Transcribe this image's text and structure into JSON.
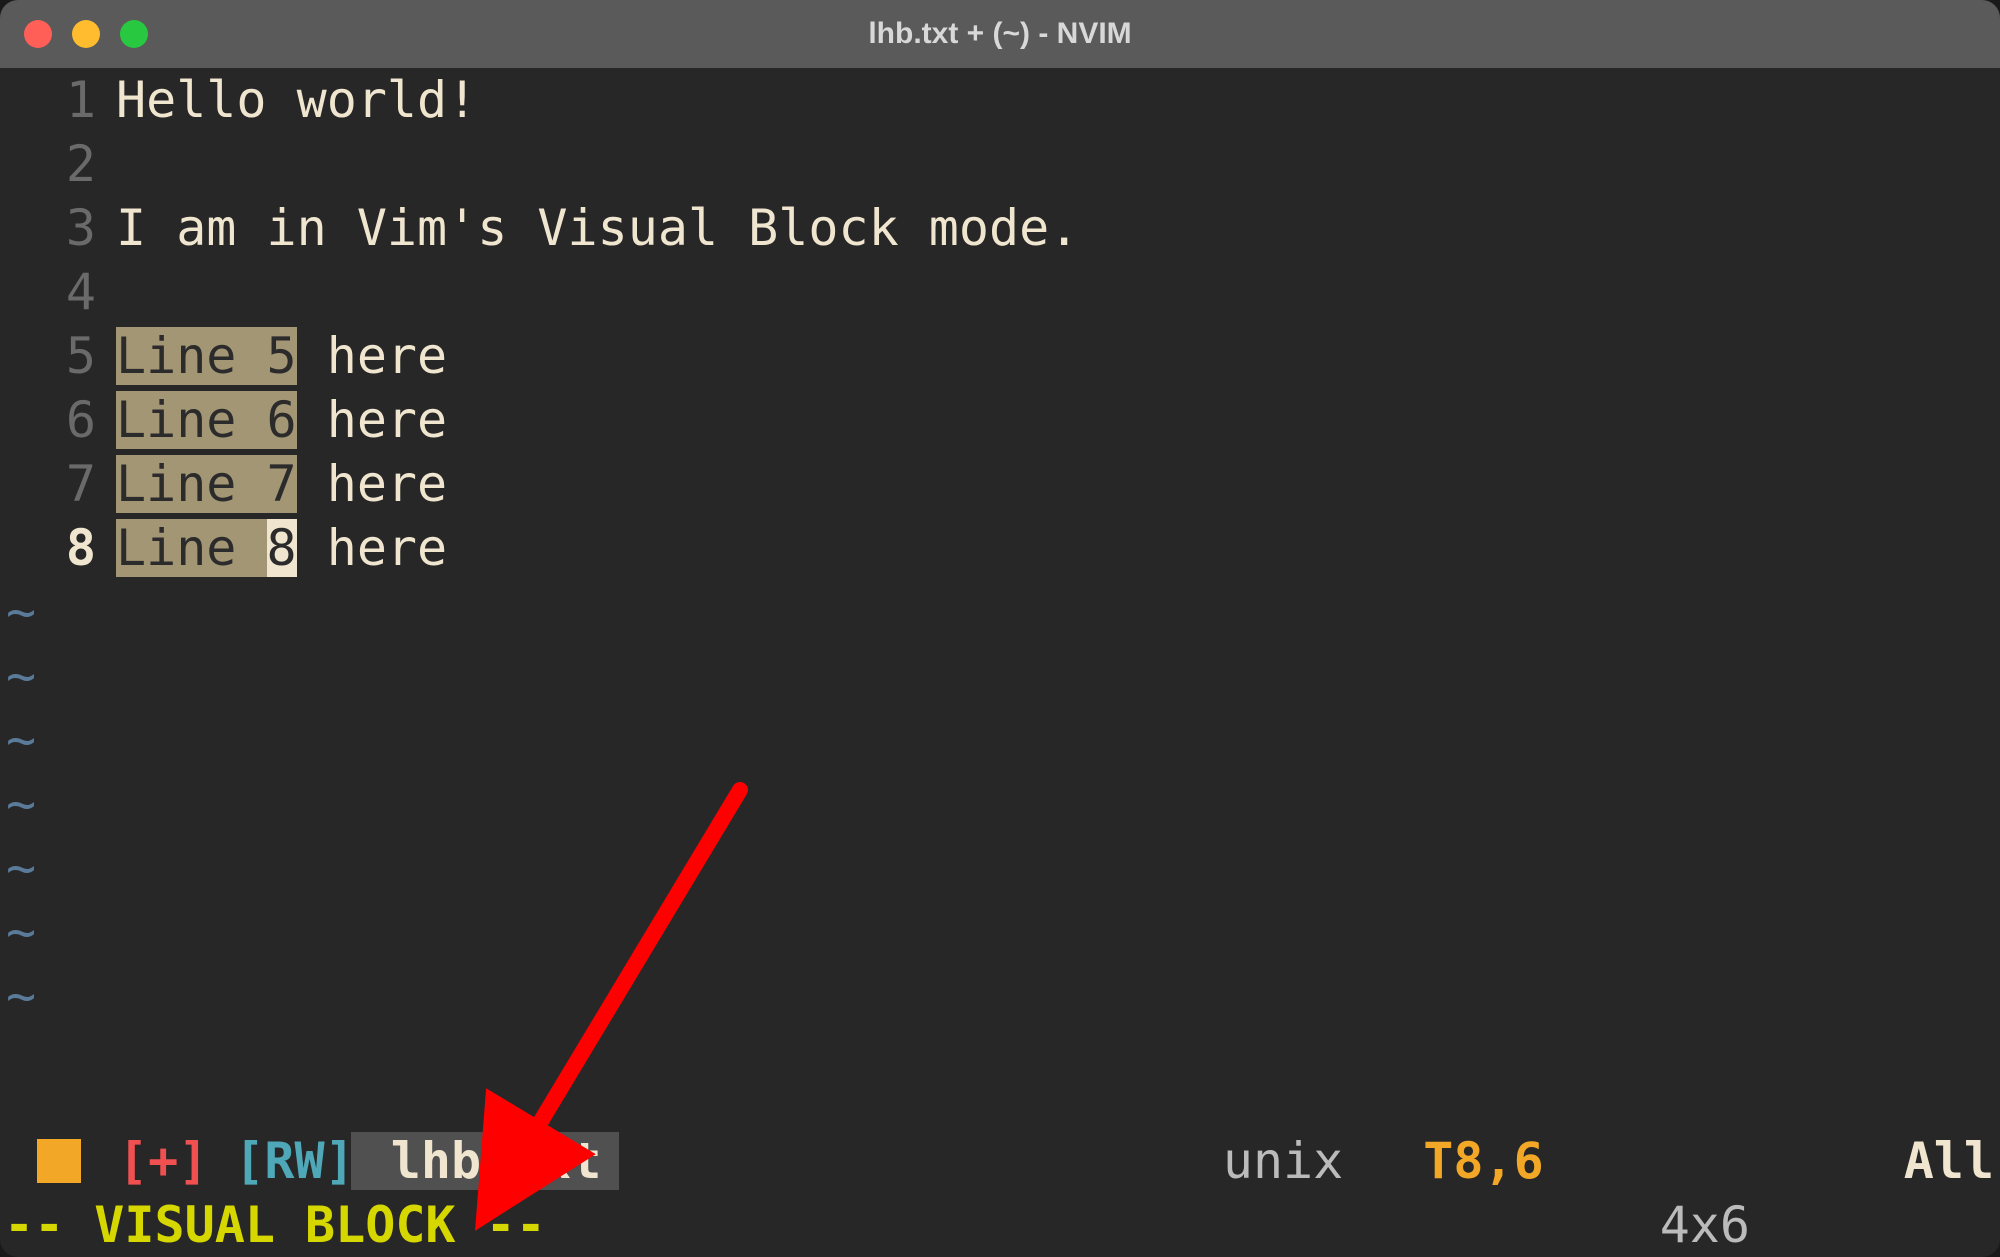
{
  "window": {
    "title": "lhb.txt + (~) - NVIM"
  },
  "buffer": {
    "lines": [
      {
        "num": "1",
        "text": "Hello world!",
        "sel": null
      },
      {
        "num": "2",
        "text": "",
        "sel": null
      },
      {
        "num": "3",
        "text": "I am in Vim's Visual Block mode.",
        "sel": null
      },
      {
        "num": "4",
        "text": "",
        "sel": null
      },
      {
        "num": "5",
        "text": "Line 5 here",
        "sel": [
          0,
          6
        ]
      },
      {
        "num": "6",
        "text": "Line 6 here",
        "sel": [
          0,
          6
        ]
      },
      {
        "num": "7",
        "text": "Line 7 here",
        "sel": [
          0,
          6
        ]
      },
      {
        "num": "8",
        "text": "Line 8 here",
        "sel": [
          0,
          6
        ],
        "cursor": 5,
        "current": true
      }
    ],
    "tilde_count": 7
  },
  "statusline": {
    "modified": "[+]",
    "rw": "[RW]",
    "filename": "lhb.txt",
    "filetype": "unix",
    "position": "T8,6",
    "percent": "All"
  },
  "mode": {
    "text": "-- VISUAL BLOCK --",
    "range": "4x6"
  },
  "colors": {
    "bg": "#272727",
    "fg": "#f0e6d0",
    "selection_bg": "#a39675",
    "cursor_bg": "#f0e6d0",
    "accent": "#f3a726",
    "mode_fg": "#d7d700"
  }
}
